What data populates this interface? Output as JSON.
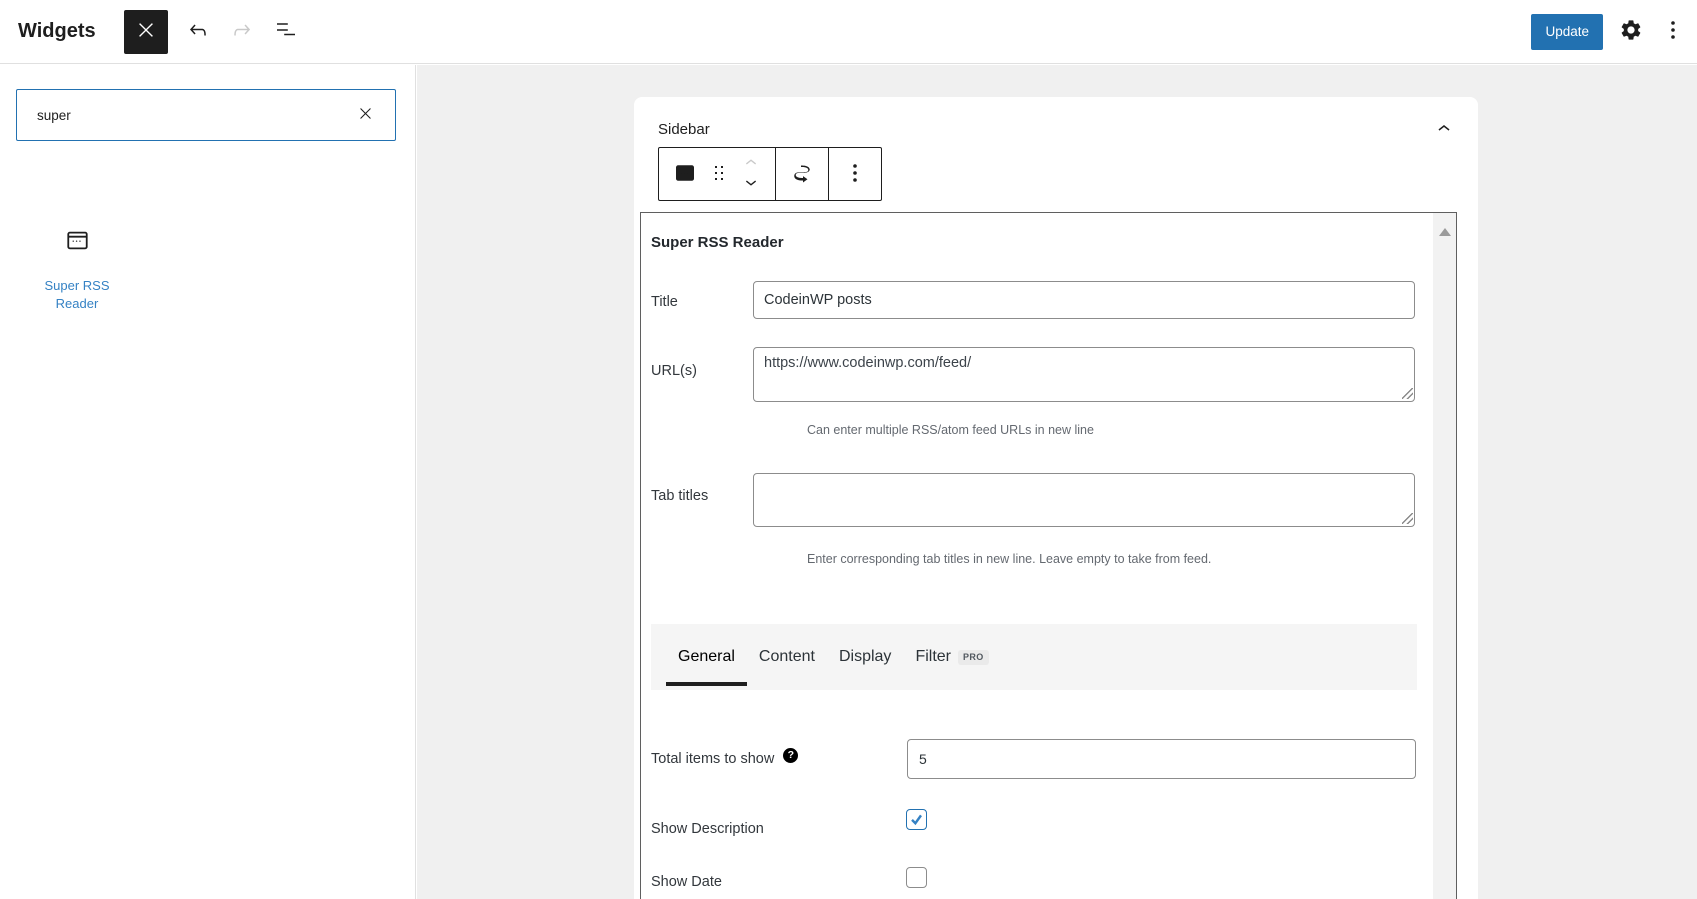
{
  "colors": {
    "accent": "#2271b1",
    "link_blue": "#3582c4"
  },
  "header": {
    "title": "Widgets",
    "update_label": "Update"
  },
  "inserter": {
    "search_value": "super",
    "item_label": "Super RSS Reader"
  },
  "widget_area": {
    "title": "Sidebar"
  },
  "form": {
    "heading": "Super RSS Reader",
    "title_field": {
      "label": "Title",
      "value": "CodeinWP posts"
    },
    "urls_field": {
      "label": "URL(s)",
      "value": "https://www.codeinwp.com/feed/",
      "help": "Can enter multiple RSS/atom feed URLs in new line"
    },
    "tab_titles_field": {
      "label": "Tab titles",
      "value": "",
      "help": "Enter corresponding tab titles in new line. Leave empty to take from feed."
    },
    "tabs": [
      {
        "label": "General",
        "active": true
      },
      {
        "label": "Content",
        "active": false
      },
      {
        "label": "Display",
        "active": false
      },
      {
        "label": "Filter",
        "badge": "PRO",
        "active": false
      }
    ],
    "general_tab": {
      "total_items": {
        "label": "Total items to show",
        "help_icon": "?",
        "value": "5"
      },
      "show_description": {
        "label": "Show Description",
        "checked": true
      },
      "show_date": {
        "label": "Show Date",
        "checked": false
      }
    }
  }
}
